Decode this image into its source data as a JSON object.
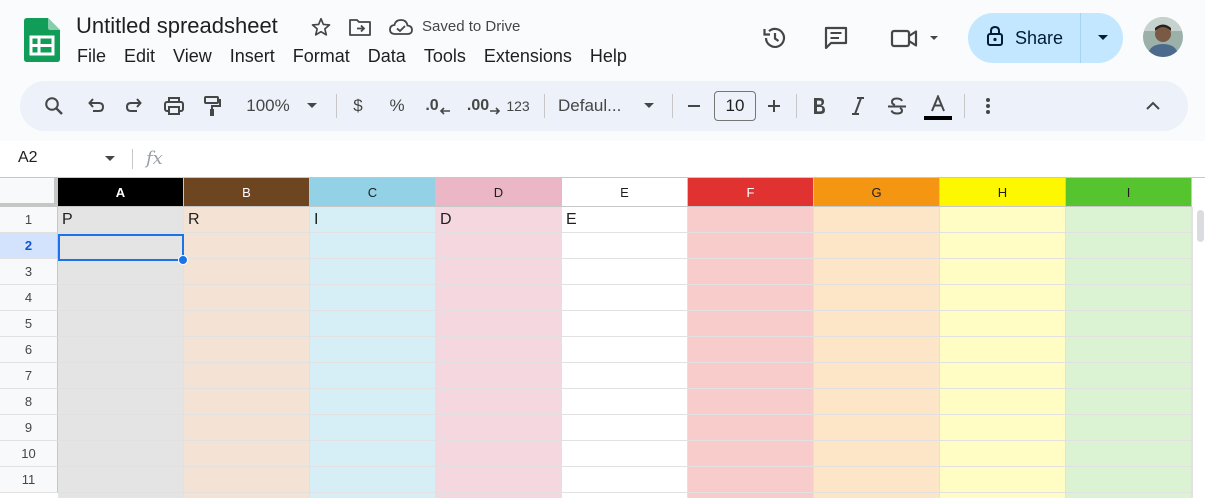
{
  "app": {
    "title": "Untitled spreadsheet",
    "saved_status": "Saved to Drive",
    "logo_icon": "sheets-logo-icon"
  },
  "menu": [
    "File",
    "Edit",
    "View",
    "Insert",
    "Format",
    "Data",
    "Tools",
    "Extensions",
    "Help"
  ],
  "header": {
    "share_label": "Share",
    "icons": [
      "star-icon",
      "move-to-folder-icon",
      "cloud-saved-icon",
      "version-history-icon",
      "comments-icon",
      "meet-video-icon",
      "lock-icon",
      "avatar"
    ]
  },
  "toolbar": {
    "zoom": "100%",
    "currency": "$",
    "percent": "%",
    "decrease_decimal": ".0",
    "increase_decimal": ".00",
    "more_formats": "123",
    "font": "Defaul...",
    "font_size": "10",
    "text_color": "#000000"
  },
  "formula_bar": {
    "name_box": "A2",
    "fx_label": "fx",
    "content": ""
  },
  "sheet": {
    "columns": [
      {
        "name": "A",
        "header_bg": "#000000",
        "header_fg": "#ffffff",
        "cell_bg": "#e4e4e4"
      },
      {
        "name": "B",
        "header_bg": "#6d4520",
        "header_fg": "#ffffff",
        "cell_bg": "#f4e3d5"
      },
      {
        "name": "C",
        "header_bg": "#93d2e6",
        "header_fg": "#1f1f1f",
        "cell_bg": "#d6eef6"
      },
      {
        "name": "D",
        "header_bg": "#ebb6c6",
        "header_fg": "#1f1f1f",
        "cell_bg": "#f5d7e0"
      },
      {
        "name": "E",
        "header_bg": "#ffffff",
        "header_fg": "#1f1f1f",
        "cell_bg": "#ffffff"
      },
      {
        "name": "F",
        "header_bg": "#e03331",
        "header_fg": "#ffffff",
        "cell_bg": "#f7cccb"
      },
      {
        "name": "G",
        "header_bg": "#f49611",
        "header_fg": "#1f1f1f",
        "cell_bg": "#fde6c7"
      },
      {
        "name": "H",
        "header_bg": "#fdf801",
        "header_fg": "#1f1f1f",
        "cell_bg": "#fffdc4"
      },
      {
        "name": "I",
        "header_bg": "#56c42e",
        "header_fg": "#1f1f1f",
        "cell_bg": "#dbf2d3"
      }
    ],
    "rows": [
      "1",
      "2",
      "3",
      "4",
      "5",
      "6",
      "7",
      "8",
      "9",
      "10",
      "11"
    ],
    "selected_row": "2",
    "selected_cell": "A2",
    "row1_values": [
      "P",
      "R",
      "I",
      "D",
      "E",
      "",
      "",
      "",
      ""
    ]
  }
}
